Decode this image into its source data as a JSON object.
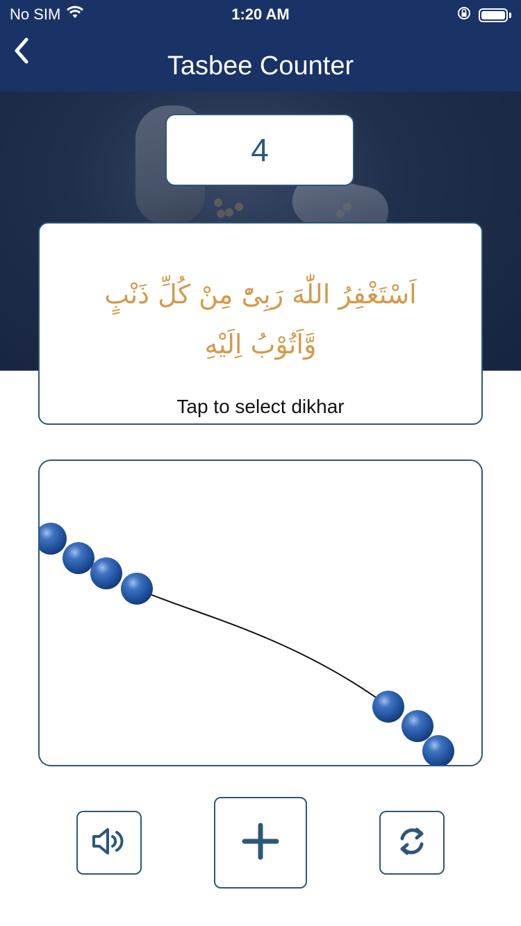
{
  "status": {
    "carrier": "No SIM",
    "time": "1:20 AM"
  },
  "nav": {
    "title": "Tasbee Counter"
  },
  "counter": {
    "value": "4"
  },
  "dhikr": {
    "line1": "اَسْتَغْفِرُ اللّٰهَ رَبِیّْ مِنْ کُلِّ ذَنْبٍ",
    "line2": "وَّاَتُوْبُ اِلَیْهِ",
    "hint": "Tap to select dikhar"
  },
  "colors": {
    "header": "#1a3366",
    "accent": "#2c5878",
    "arabic_text": "#d29b4d",
    "bead": "#1e4f9a"
  },
  "controls": {
    "sound_icon": "speaker-volume-icon",
    "add_icon": "plus-icon",
    "reset_icon": "refresh-icon"
  }
}
